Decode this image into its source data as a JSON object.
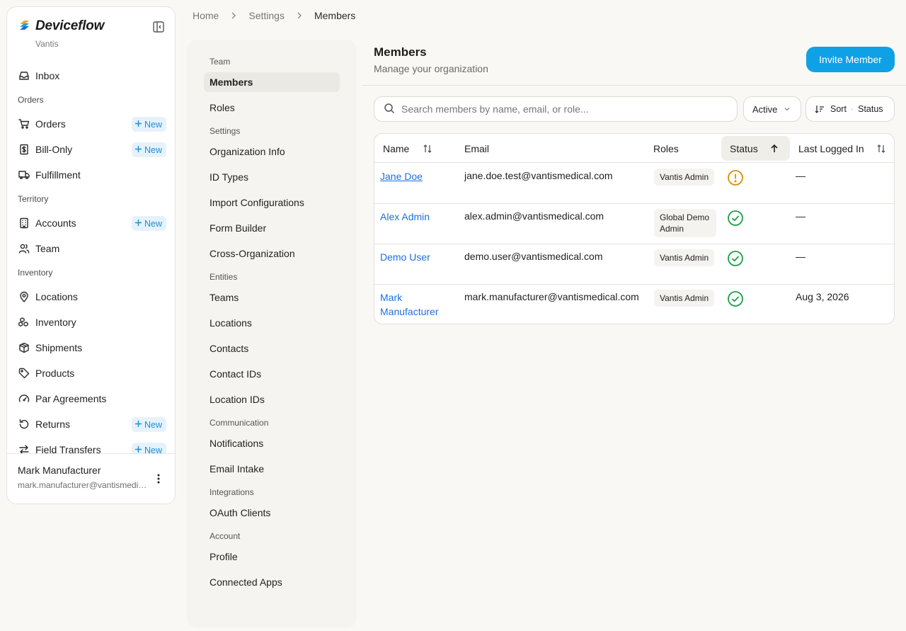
{
  "app": {
    "name": "Deviceflow",
    "org": "Vantis",
    "colors": {
      "accent": "#0ea1e6",
      "link": "#1e6fdc",
      "success": "#1e9e4a",
      "warning": "#d99100"
    }
  },
  "sidebar": {
    "items": [
      {
        "type": "item",
        "label": "Inbox",
        "icon": "inbox-icon"
      },
      {
        "type": "group",
        "label": "Orders"
      },
      {
        "type": "item",
        "label": "Orders",
        "icon": "cart-icon",
        "new": "New"
      },
      {
        "type": "item",
        "label": "Bill-Only",
        "icon": "invoice-icon",
        "new": "New"
      },
      {
        "type": "item",
        "label": "Fulfillment",
        "icon": "truck-icon"
      },
      {
        "type": "group",
        "label": "Territory"
      },
      {
        "type": "item",
        "label": "Accounts",
        "icon": "building-icon",
        "new": "New"
      },
      {
        "type": "item",
        "label": "Team",
        "icon": "users-icon"
      },
      {
        "type": "group",
        "label": "Inventory"
      },
      {
        "type": "item",
        "label": "Locations",
        "icon": "map-pin-icon"
      },
      {
        "type": "item",
        "label": "Inventory",
        "icon": "boxes-icon"
      },
      {
        "type": "item",
        "label": "Shipments",
        "icon": "package-icon"
      },
      {
        "type": "item",
        "label": "Products",
        "icon": "tag-icon"
      },
      {
        "type": "item",
        "label": "Par Agreements",
        "icon": "gauge-icon"
      },
      {
        "type": "item",
        "label": "Returns",
        "icon": "return-icon",
        "new": "New"
      },
      {
        "type": "item",
        "label": "Field Transfers",
        "icon": "transfer-icon",
        "new": "New"
      }
    ],
    "user": {
      "name": "Mark Manufacturer",
      "email": "mark.manufacturer@vantismedical.com"
    }
  },
  "breadcrumb": [
    "Home",
    "Settings",
    "Members"
  ],
  "settings_menu": {
    "sections": [
      {
        "label": "Team",
        "items": [
          "Members",
          "Roles"
        ]
      },
      {
        "label": "Settings",
        "items": [
          "Organization Info",
          "ID Types",
          "Import Configurations",
          "Form Builder",
          "Cross-Organization"
        ]
      },
      {
        "label": "Entities",
        "items": [
          "Teams",
          "Locations",
          "Contacts",
          "Contact IDs",
          "Location IDs"
        ]
      },
      {
        "label": "Communication",
        "items": [
          "Notifications",
          "Email Intake"
        ]
      },
      {
        "label": "Integrations",
        "items": [
          "OAuth Clients"
        ]
      },
      {
        "label": "Account",
        "items": [
          "Profile",
          "Connected Apps"
        ]
      }
    ],
    "active": "Members"
  },
  "main": {
    "title": "Members",
    "subtitle": "Manage your organization",
    "invite_label": "Invite Member",
    "search_placeholder": "Search members by name, email, or role...",
    "filter_label": "Active",
    "sort_label": "Sort",
    "sort_value": "Status",
    "columns": [
      "Name",
      "Email",
      "Roles",
      "Status",
      "Last Logged In"
    ],
    "rows": [
      {
        "name": "Jane Doe",
        "email": "jane.doe.test@vantismedical.com",
        "role": "Vantis Admin",
        "status": "warning",
        "last_login": "—"
      },
      {
        "name": "Alex Admin",
        "email": "alex.admin@vantismedical.com",
        "role": "Global Demo Admin",
        "status": "active",
        "last_login": "—"
      },
      {
        "name": "Demo User",
        "email": "demo.user@vantismedical.com",
        "role": "Vantis Admin",
        "status": "active",
        "last_login": "—"
      },
      {
        "name": "Mark Manufacturer",
        "email": "mark.manufacturer@vantismedical.com",
        "role": "Vantis Admin",
        "status": "active",
        "last_login": "Aug 3, 2026"
      }
    ]
  }
}
